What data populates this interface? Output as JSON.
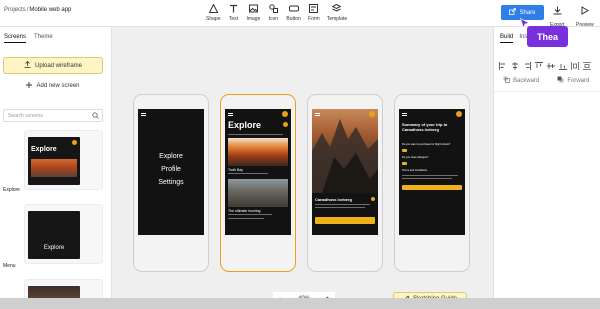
{
  "breadcrumb": {
    "parent": "Projects",
    "separator": "/",
    "current": "Mobile web app"
  },
  "toolbar": [
    {
      "label": "Shape",
      "icon": "shape-icon"
    },
    {
      "label": "Text",
      "icon": "text-icon"
    },
    {
      "label": "Image",
      "icon": "image-icon"
    },
    {
      "label": "Icon",
      "icon": "icon-icon"
    },
    {
      "label": "Button",
      "icon": "button-icon"
    },
    {
      "label": "Form",
      "icon": "form-icon"
    },
    {
      "label": "Template",
      "icon": "template-icon"
    }
  ],
  "top_right": {
    "share": "Share",
    "export": "Export",
    "preview": "Preview"
  },
  "collaborator_tag": "Thea",
  "left_panel": {
    "tabs": [
      "Screens",
      "Theme"
    ],
    "upload_label": "Upload wireframe",
    "add_screen_label": "Add new screen",
    "search_placeholder": "Search screens",
    "screens": [
      {
        "label": "Explore",
        "thumb_title": "Explore"
      },
      {
        "label": "Menu",
        "thumb_title": "Explore"
      }
    ]
  },
  "canvas": {
    "phones": [
      {
        "id": "menu",
        "menu_items": [
          "Explore",
          "Profile",
          "Settings"
        ]
      },
      {
        "id": "explore",
        "title": "Explore",
        "card1": "Truth Bay",
        "card2": "The ultimate hushing"
      },
      {
        "id": "detail",
        "title": "Canadhoss Iceberg"
      },
      {
        "id": "summary",
        "heading": "Summary of your trip to Canadhoss Iceberg",
        "q1": "Do you want to purchase for flight tickets?",
        "q2": "Do you have allergies?",
        "terms": "Terms and Conditions"
      }
    ],
    "zoom": {
      "minus": "−",
      "value": "40%",
      "plus": "+"
    },
    "sketching_label": "Sketching Guide"
  },
  "right_panel": {
    "tabs": [
      "Build",
      "Inspect",
      "Comment"
    ],
    "tabs_display": [
      "Build",
      "Ins",
      "nt"
    ],
    "order": {
      "backward": "Backward",
      "forward": "Forward"
    }
  },
  "colors": {
    "accent": "#2f7ee8",
    "collab": "#7a2fdc",
    "highlight": "#fdf6c4",
    "brand_yellow": "#f0b01b"
  }
}
